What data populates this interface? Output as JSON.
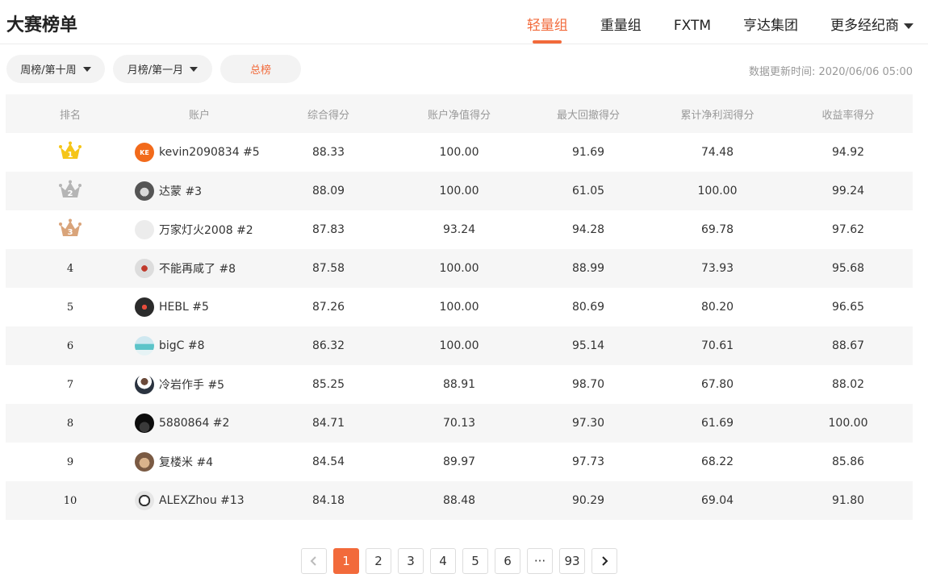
{
  "header": {
    "title": "大赛榜单",
    "tabs": [
      "轻量组",
      "重量组",
      "FXTM",
      "亨达集团",
      "更多经纪商"
    ],
    "active_tab": 0
  },
  "filters": {
    "week_label": "周榜/第十周",
    "month_label": "月榜/第一月",
    "total_label": "总榜",
    "update_time": "数据更新时间: 2020/06/06 05:00"
  },
  "colors": {
    "accent": "#f26a3b",
    "gold": "#f5c518",
    "silver": "#b5b5b5",
    "bronze": "#d9a47a"
  },
  "table": {
    "columns": [
      "排名",
      "账户",
      "综合得分",
      "账户净值得分",
      "最大回撤得分",
      "累计净利润得分",
      "收益率得分"
    ],
    "rows": [
      {
        "rank": "1",
        "medal": "gold",
        "avatar": "orange-initials",
        "avatar_text": "KE",
        "account": "kevin2090834 #5",
        "score": "88.33",
        "nav": "100.00",
        "dd": "91.69",
        "profit": "74.48",
        "ret": "94.92"
      },
      {
        "rank": "2",
        "medal": "silver",
        "avatar": "photo-gray",
        "avatar_text": "",
        "account": "达蒙 #3",
        "score": "88.09",
        "nav": "100.00",
        "dd": "61.05",
        "profit": "100.00",
        "ret": "99.24"
      },
      {
        "rank": "3",
        "medal": "bronze",
        "avatar": "blank-gray",
        "avatar_text": "",
        "account": "万家灯火2008 #2",
        "score": "87.83",
        "nav": "93.24",
        "dd": "94.28",
        "profit": "69.78",
        "ret": "97.62"
      },
      {
        "rank": "4",
        "medal": "",
        "avatar": "photo-figure",
        "avatar_text": "",
        "account": "不能再咸了 #8",
        "score": "87.58",
        "nav": "100.00",
        "dd": "88.99",
        "profit": "73.93",
        "ret": "95.68"
      },
      {
        "rank": "5",
        "medal": "",
        "avatar": "photo-dark",
        "avatar_text": "",
        "account": "HEBL #5",
        "score": "87.26",
        "nav": "100.00",
        "dd": "80.69",
        "profit": "80.20",
        "ret": "96.65"
      },
      {
        "rank": "6",
        "medal": "",
        "avatar": "photo-sea",
        "avatar_text": "",
        "account": "bigC #8",
        "score": "86.32",
        "nav": "100.00",
        "dd": "95.14",
        "profit": "70.61",
        "ret": "88.67"
      },
      {
        "rank": "7",
        "medal": "",
        "avatar": "photo-person",
        "avatar_text": "",
        "account": "冷岩作手 #5",
        "score": "85.25",
        "nav": "88.91",
        "dd": "98.70",
        "profit": "67.80",
        "ret": "88.02"
      },
      {
        "rank": "8",
        "medal": "",
        "avatar": "photo-black",
        "avatar_text": "",
        "account": "5880864 #2",
        "score": "84.71",
        "nav": "70.13",
        "dd": "97.30",
        "profit": "61.69",
        "ret": "100.00"
      },
      {
        "rank": "9",
        "medal": "",
        "avatar": "photo-face",
        "avatar_text": "",
        "account": "复楼米 #4",
        "score": "84.54",
        "nav": "89.97",
        "dd": "97.73",
        "profit": "68.22",
        "ret": "85.86"
      },
      {
        "rank": "10",
        "medal": "",
        "avatar": "photo-badge",
        "avatar_text": "",
        "account": "ALEXZhou #13",
        "score": "84.18",
        "nav": "88.48",
        "dd": "90.29",
        "profit": "69.04",
        "ret": "91.80"
      }
    ]
  },
  "pagination": {
    "prev_icon": "chevron-left-icon",
    "next_icon": "chevron-right-icon",
    "pages": [
      "1",
      "2",
      "3",
      "4",
      "5",
      "6",
      "···",
      "93"
    ],
    "current": "1"
  }
}
